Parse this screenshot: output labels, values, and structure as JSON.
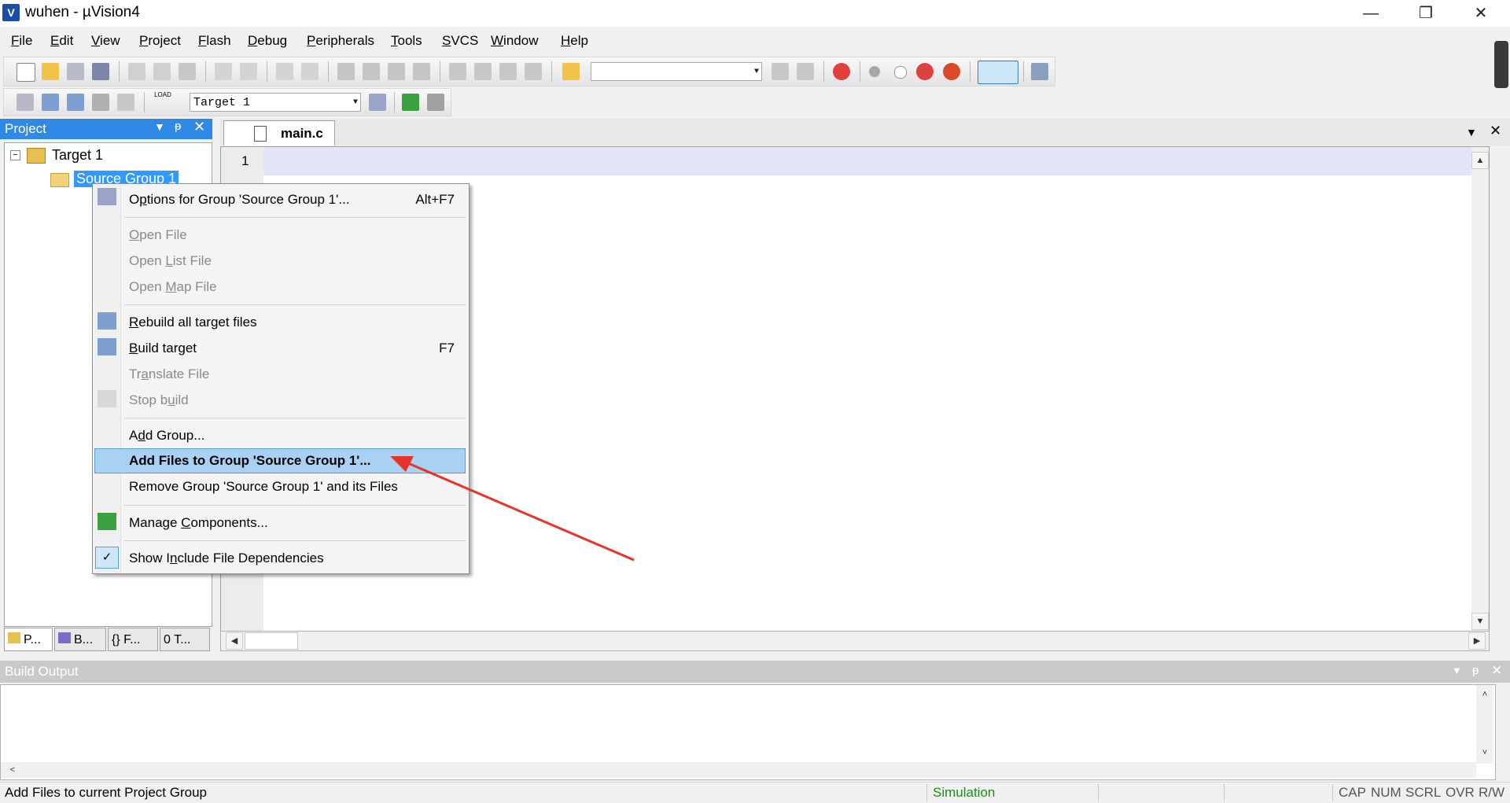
{
  "window": {
    "title": "wuhen  - µVision4",
    "app_icon_label": "V",
    "minimize_glyph": "—",
    "restore_glyph": "❐",
    "close_glyph": "✕"
  },
  "menu": [
    {
      "label": "File",
      "u": "F",
      "rest": "ile"
    },
    {
      "label": "Edit",
      "u": "E",
      "rest": "dit"
    },
    {
      "label": "View",
      "u": "V",
      "rest": "iew"
    },
    {
      "label": "Project",
      "u": "P",
      "rest": "roject"
    },
    {
      "label": "Flash",
      "u": "F",
      "rest": "lash"
    },
    {
      "label": "Debug",
      "u": "D",
      "rest": "ebug"
    },
    {
      "label": "Peripherals",
      "u": "P",
      "rest": "eripherals"
    },
    {
      "label": "Tools",
      "u": "T",
      "rest": "ools"
    },
    {
      "label": "SVCS",
      "u": "S",
      "rest": "VCS"
    },
    {
      "label": "Window",
      "u": "W",
      "rest": "indow"
    },
    {
      "label": "Help",
      "u": "H",
      "rest": "elp"
    }
  ],
  "toolbar2": {
    "load_label": "LOAD",
    "target_select": "Target 1"
  },
  "project_panel": {
    "title": "Project",
    "root": "Target 1",
    "group": "Source Group 1",
    "tabs": [
      "P...",
      "B...",
      "F...",
      "T..."
    ],
    "tab_glyphs": [
      "",
      "",
      "{}",
      "0"
    ]
  },
  "editor": {
    "tab": "main.c",
    "line_number": "1"
  },
  "context_menu": {
    "items": [
      {
        "pre": "O",
        "u": "p",
        "post": "tions for Group 'Source Group 1'...",
        "shortcut": "Alt+F7",
        "disabled": false
      },
      {
        "pre": "",
        "u": "O",
        "post": "pen File",
        "shortcut": "",
        "disabled": true
      },
      {
        "pre": "Open ",
        "u": "L",
        "post": "ist File",
        "shortcut": "",
        "disabled": true
      },
      {
        "pre": "Open ",
        "u": "M",
        "post": "ap File",
        "shortcut": "",
        "disabled": true
      },
      {
        "pre": "",
        "u": "R",
        "post": "ebuild all target files",
        "shortcut": "",
        "disabled": false
      },
      {
        "pre": "",
        "u": "B",
        "post": "uild target",
        "shortcut": "F7",
        "disabled": false
      },
      {
        "pre": "Tr",
        "u": "a",
        "post": "nslate File",
        "shortcut": "",
        "disabled": true
      },
      {
        "pre": "Stop b",
        "u": "u",
        "post": "ild",
        "shortcut": "",
        "disabled": true
      },
      {
        "pre": "A",
        "u": "d",
        "post": "d Group...",
        "shortcut": "",
        "disabled": false
      },
      {
        "pre": "Add Files to Group 'Source Group 1'...",
        "u": "",
        "post": "",
        "shortcut": "",
        "disabled": false
      },
      {
        "pre": "Remove Group 'Source Group 1' and its Files",
        "u": "",
        "post": "",
        "shortcut": "",
        "disabled": false
      },
      {
        "pre": "Manage ",
        "u": "C",
        "post": "omponents...",
        "shortcut": "",
        "disabled": false
      },
      {
        "pre": "Show I",
        "u": "n",
        "post": "clude File Dependencies",
        "shortcut": "",
        "disabled": false
      }
    ],
    "checkmark": "✓"
  },
  "build_output": {
    "title": "Build Output"
  },
  "status_bar": {
    "message": "Add Files to current Project Group",
    "mode": "Simulation",
    "indicators": [
      "CAP",
      "NUM",
      "SCRL",
      "OVR",
      "R/W"
    ]
  },
  "colors": {
    "panel_header": "#2e8ae6",
    "selection": "#a9d2f2",
    "annotation_arrow": "#e8322a",
    "status_mode": "#1f8a1f"
  }
}
